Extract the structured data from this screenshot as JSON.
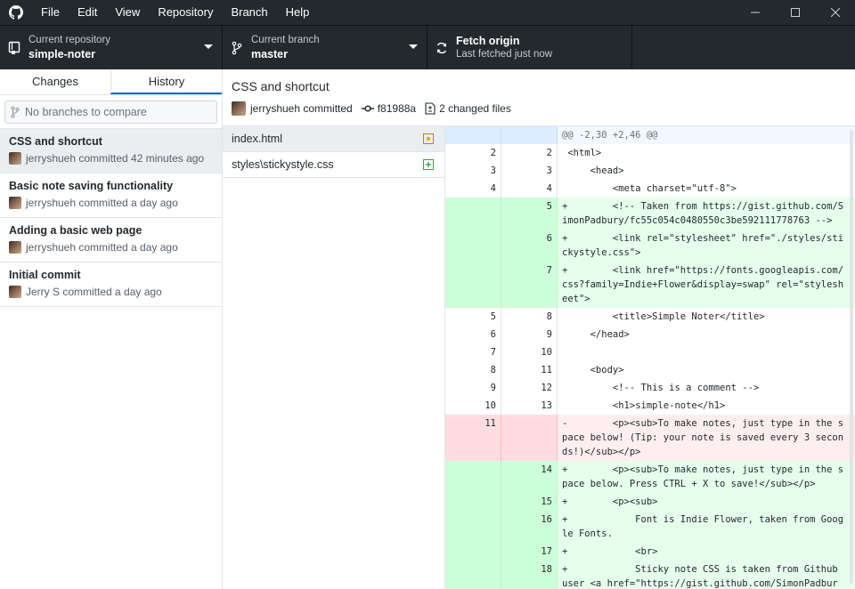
{
  "menu": [
    "File",
    "Edit",
    "View",
    "Repository",
    "Branch",
    "Help"
  ],
  "toolbar": {
    "repo_label": "Current repository",
    "repo_value": "simple-noter",
    "branch_label": "Current branch",
    "branch_value": "master",
    "fetch_label": "Fetch origin",
    "fetch_status": "Last fetched just now"
  },
  "sidebar": {
    "tabs": [
      "Changes",
      "History"
    ],
    "selected_tab": "History",
    "compare_placeholder": "No branches to compare",
    "commits": [
      {
        "title": "CSS and shortcut",
        "meta": "jerryshueh committed 42 minutes ago"
      },
      {
        "title": "Basic note saving functionality",
        "meta": "jerryshueh committed a day ago"
      },
      {
        "title": "Adding a basic web page",
        "meta": "jerryshueh committed a day ago"
      },
      {
        "title": "Initial commit",
        "meta": "Jerry S committed a day ago"
      }
    ]
  },
  "commit": {
    "title": "CSS and shortcut",
    "author": "jerryshueh committed",
    "sha": "f81988a",
    "changed": "2 changed files"
  },
  "files": [
    {
      "path": "index.html",
      "status": "modified"
    },
    {
      "path": "styles\\stickystyle.css",
      "status": "added"
    }
  ],
  "diff": [
    {
      "type": "hunk",
      "old": "",
      "new": "",
      "text": "@@ -2,30 +2,46 @@"
    },
    {
      "type": "ctx",
      "old": "2",
      "new": "2",
      "text": " <html>"
    },
    {
      "type": "ctx",
      "old": "3",
      "new": "3",
      "text": "     <head>"
    },
    {
      "type": "ctx",
      "old": "4",
      "new": "4",
      "text": "         <meta charset=\"utf-8\">"
    },
    {
      "type": "add",
      "old": "",
      "new": "5",
      "text": "+        <!-- Taken from https://gist.github.com/SimonPadbury/fc55c054c0480550c3be592111778763 -->"
    },
    {
      "type": "add",
      "old": "",
      "new": "6",
      "text": "+        <link rel=\"stylesheet\" href=\"./styles/stickystyle.css\">"
    },
    {
      "type": "add",
      "old": "",
      "new": "7",
      "text": "+        <link href=\"https://fonts.googleapis.com/css?family=Indie+Flower&display=swap\" rel=\"stylesheet\">"
    },
    {
      "type": "ctx",
      "old": "5",
      "new": "8",
      "text": "         <title>Simple Noter</title>"
    },
    {
      "type": "ctx",
      "old": "6",
      "new": "9",
      "text": "     </head>"
    },
    {
      "type": "ctx",
      "old": "7",
      "new": "10",
      "text": " "
    },
    {
      "type": "ctx",
      "old": "8",
      "new": "11",
      "text": "     <body>"
    },
    {
      "type": "ctx",
      "old": "9",
      "new": "12",
      "text": "         <!-- This is a comment -->"
    },
    {
      "type": "ctx",
      "old": "10",
      "new": "13",
      "text": "         <h1>simple-note</h1>"
    },
    {
      "type": "del",
      "old": "11",
      "new": "",
      "text": "-        <p><sub>To make notes, just type in the space below! (Tip: your note is saved every 3 seconds!)</sub></p>"
    },
    {
      "type": "add",
      "old": "",
      "new": "14",
      "text": "+        <p><sub>To make notes, just type in the space below. Press CTRL + X to save!</sub></p>"
    },
    {
      "type": "add",
      "old": "",
      "new": "15",
      "text": "+        <p><sub>"
    },
    {
      "type": "add",
      "old": "",
      "new": "16",
      "text": "+            Font is Indie Flower, taken from Google Fonts."
    },
    {
      "type": "add",
      "old": "",
      "new": "17",
      "text": "+            <br>"
    },
    {
      "type": "add",
      "old": "",
      "new": "18",
      "text": "+            Sticky note CSS is taken from Github user <a href=\"https://gist.github.com/SimonPadbury\">Si"
    }
  ]
}
